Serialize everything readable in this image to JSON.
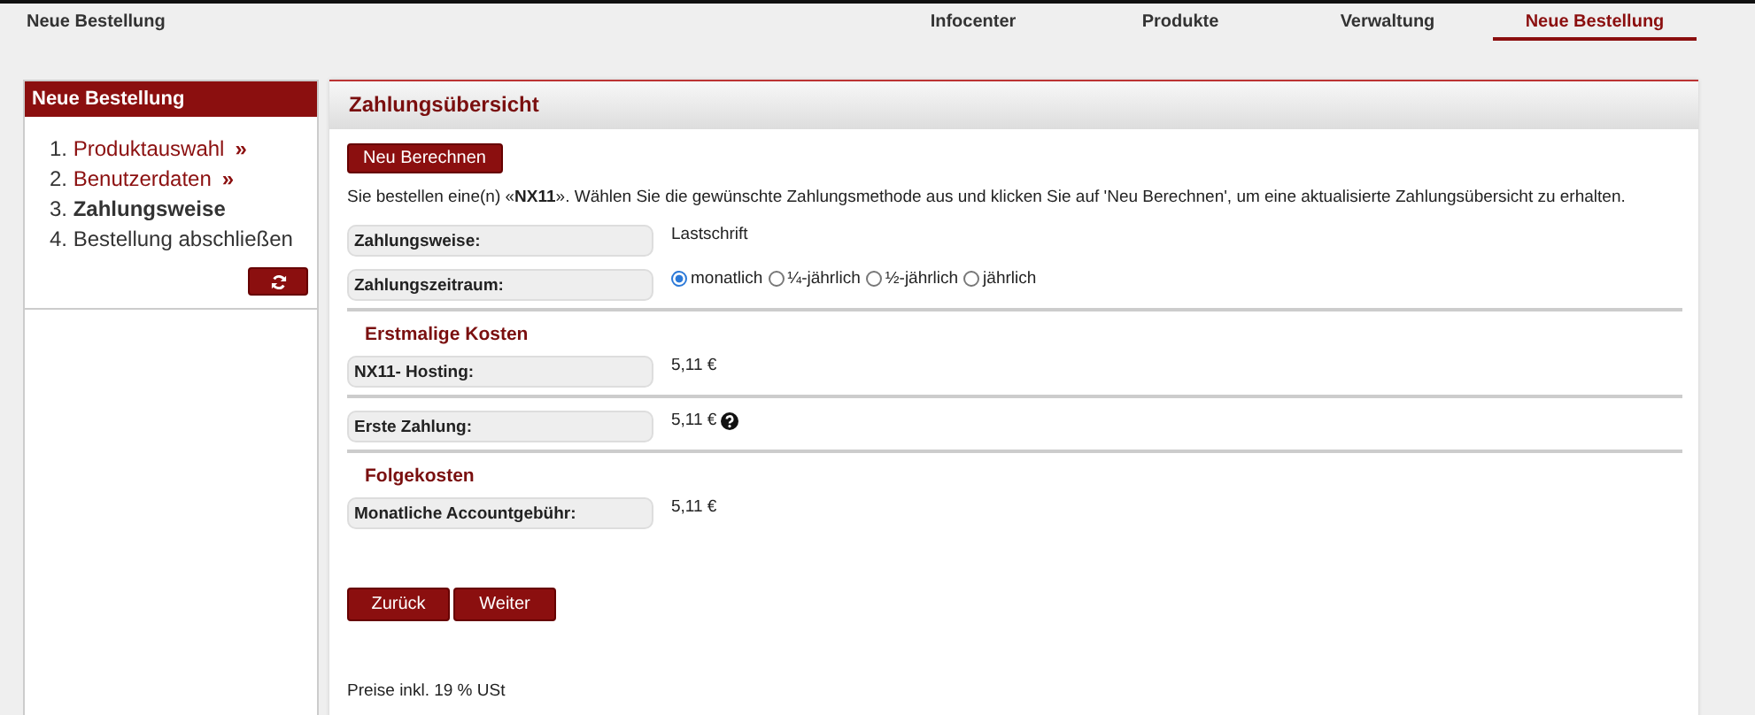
{
  "header": {
    "title": "Neue Bestellung"
  },
  "nav": [
    {
      "label": "Infocenter",
      "selected": false
    },
    {
      "label": "Produkte",
      "selected": false
    },
    {
      "label": "Verwaltung",
      "selected": false
    },
    {
      "label": "Neue Bestellung",
      "selected": true
    }
  ],
  "sidebar": {
    "title": "Neue Bestellung",
    "steps": [
      {
        "number": "1.",
        "label": "Produktauswahl",
        "kind": "link",
        "arrow": "»"
      },
      {
        "number": "2.",
        "label": "Benutzerdaten",
        "kind": "link",
        "arrow": "»"
      },
      {
        "number": "3.",
        "label": "Zahlungsweise",
        "kind": "current"
      },
      {
        "number": "4.",
        "label": "Bestellung abschließen",
        "kind": "plain"
      }
    ]
  },
  "main": {
    "title": "Zahlungsübersicht",
    "recalc_button": "Neu Berechnen",
    "intro": "Sie bestellen eine(n) «**NX11**». Wählen Sie die gewünschte Zahlungsmethode aus und klicken Sie auf 'Neu Berechnen', um eine aktualisierte Zahlungsübersicht zu erhalten.",
    "rows": [
      {
        "kind": "field",
        "label": "Zahlungsweise:",
        "value": "Lastschrift"
      },
      {
        "kind": "radio",
        "label": "Zahlungszeitraum:",
        "options": [
          {
            "label": "monatlich",
            "selected": true
          },
          {
            "label": "¼-jährlich",
            "selected": false
          },
          {
            "label": "½-jährlich",
            "selected": false
          },
          {
            "label": "jährlich",
            "selected": false
          }
        ]
      },
      {
        "kind": "divider"
      },
      {
        "kind": "heading",
        "text": "Erstmalige Kosten"
      },
      {
        "kind": "field",
        "label": "NX11- Hosting:",
        "value": "5,11 €"
      },
      {
        "kind": "divider"
      },
      {
        "kind": "field",
        "label": "Erste Zahlung:",
        "value": "5,11 €",
        "help": true
      },
      {
        "kind": "divider"
      },
      {
        "kind": "heading",
        "text": "Folgekosten"
      },
      {
        "kind": "field",
        "label": "Monatliche Accountgebühr:",
        "value": "5,11 €"
      }
    ],
    "buttons": [
      "Zurück",
      "Weiter"
    ],
    "footnote": "Preise inkl. 19 % USt"
  }
}
